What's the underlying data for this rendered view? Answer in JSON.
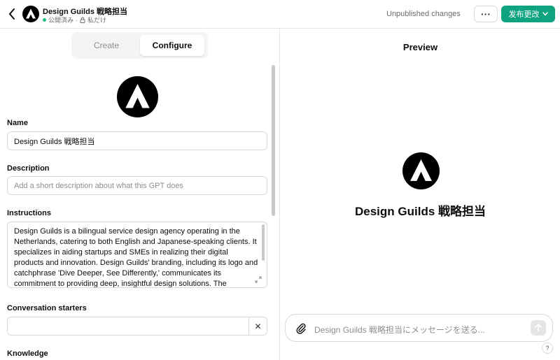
{
  "header": {
    "gpt_name": "Design Guilds 戦略担当",
    "status_published": "公開済み",
    "separator": "·",
    "visibility": "私だけ",
    "unpublished": "Unpublished changes",
    "more_label": "···",
    "publish_label": "发布更改"
  },
  "tabs": {
    "create": "Create",
    "configure": "Configure"
  },
  "form": {
    "name_label": "Name",
    "name_value": "Design Guilds 戦略担当",
    "description_label": "Description",
    "description_placeholder": "Add a short description about what this GPT does",
    "instructions_label": "Instructions",
    "instructions_value": "Design Guilds is a bilingual service design agency operating in the Netherlands, catering to both English and Japanese-speaking clients. It specializes in aiding startups and SMEs in realizing their digital products and innovation. Design Guilds' branding, including its logo and catchphrase 'Dive Deeper, See Differently,' communicates its commitment to providing deep, insightful design solutions. The agency's foundational",
    "starters_label": "Conversation starters",
    "starter_clear": "✕",
    "knowledge_label": "Knowledge"
  },
  "preview": {
    "title": "Preview",
    "gpt_name": "Design Guilds 戦略担当",
    "composer_placeholder": "Design Guilds 戦略担当にメッセージを送る..."
  },
  "help_label": "?",
  "colors": {
    "accent": "#10a37f",
    "status_green": "#19c37d",
    "logo_bg": "#000000"
  },
  "icons": {
    "back": "chevron-left-icon",
    "lock": "lock-icon",
    "chevron": "chevron-down-icon",
    "attach": "paperclip-icon",
    "send": "arrow-up-icon",
    "expand": "expand-icon"
  }
}
